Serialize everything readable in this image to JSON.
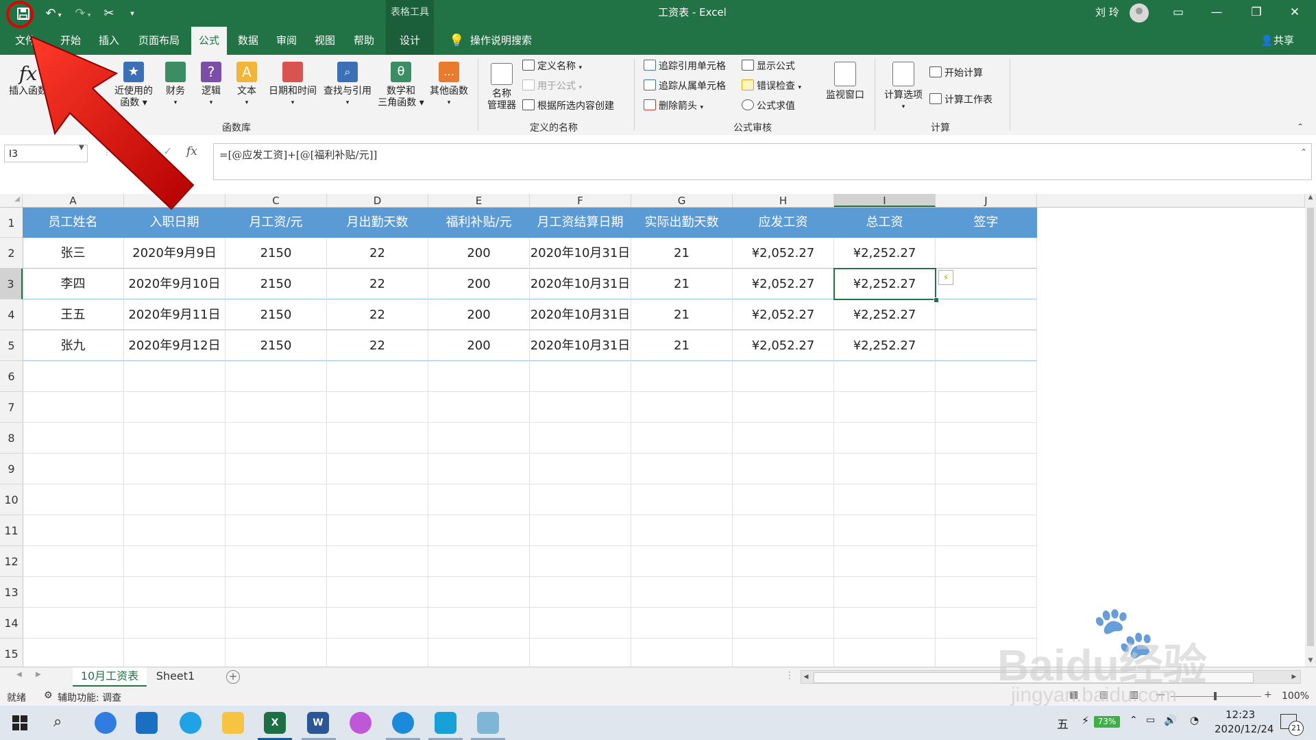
{
  "titlebar": {
    "context_tools": "表格工具",
    "window_title": "工资表 - Excel",
    "user": "刘 玲"
  },
  "tabs": [
    {
      "label": "文件"
    },
    {
      "label": "开始"
    },
    {
      "label": "插入"
    },
    {
      "label": "页面布局"
    },
    {
      "label": "公式"
    },
    {
      "label": "数据"
    },
    {
      "label": "审阅"
    },
    {
      "label": "视图"
    },
    {
      "label": "帮助"
    },
    {
      "label": "设计"
    }
  ],
  "tell_me": "操作说明搜索",
  "share": "共享",
  "ribbon": {
    "function_library": {
      "label": "函数库",
      "insert_function": "插入函数",
      "recent": [
        "近使用的",
        "函数"
      ],
      "financial": "财务",
      "logical": "逻辑",
      "text": "文本",
      "datetime": "日期和时间",
      "lookup": "查找与引用",
      "math": [
        "数学和",
        "三角函数"
      ],
      "more": "其他函数"
    },
    "defined_names": {
      "label": "定义的名称",
      "name_manager": [
        "名称",
        "管理器"
      ],
      "define_name": "定义名称",
      "use_in_formula": "用于公式",
      "create_from_selection": "根据所选内容创建"
    },
    "formula_auditing": {
      "label": "公式审核",
      "trace_precedents": "追踪引用单元格",
      "trace_dependents": "追踪从属单元格",
      "remove_arrows": "删除箭头",
      "show_formulas": "显示公式",
      "error_checking": "错误检查",
      "evaluate_formula": "公式求值",
      "watch_window": "监视窗口"
    },
    "calculation": {
      "label": "计算",
      "calc_options": "计算选项",
      "calc_now": "开始计算",
      "calc_sheet": "计算工作表"
    }
  },
  "formula_bar": {
    "name_box": "I3",
    "formula": "=[@应发工资]+[@[福利补贴/元]]"
  },
  "columns": [
    "A",
    "B",
    "C",
    "D",
    "E",
    "F",
    "G",
    "H",
    "I",
    "J"
  ],
  "rows": [
    "1",
    "2",
    "3",
    "4",
    "5",
    "6",
    "7",
    "8",
    "9",
    "10",
    "11",
    "12",
    "13",
    "14",
    "15"
  ],
  "table": {
    "headers": [
      "员工姓名",
      "入职日期",
      "月工资/元",
      "月出勤天数",
      "福利补贴/元",
      "月工资结算日期",
      "实际出勤天数",
      "应发工资",
      "总工资",
      "签字"
    ],
    "rows": [
      [
        "张三",
        "2020年9月9日",
        "2150",
        "22",
        "200",
        "2020年10月31日",
        "21",
        "¥2,052.27",
        "¥2,252.27",
        ""
      ],
      [
        "李四",
        "2020年9月10日",
        "2150",
        "22",
        "200",
        "2020年10月31日",
        "21",
        "¥2,052.27",
        "¥2,252.27",
        ""
      ],
      [
        "王五",
        "2020年9月11日",
        "2150",
        "22",
        "200",
        "2020年10月31日",
        "21",
        "¥2,052.27",
        "¥2,252.27",
        ""
      ],
      [
        "张九",
        "2020年9月12日",
        "2150",
        "22",
        "200",
        "2020年10月31日",
        "21",
        "¥2,052.27",
        "¥2,252.27",
        ""
      ]
    ]
  },
  "sheets": [
    {
      "label": "10月工资表",
      "active": true
    },
    {
      "label": "Sheet1",
      "active": false
    }
  ],
  "status": {
    "ready": "就绪",
    "accessibility": "辅助功能: 调查",
    "zoom": "100%"
  },
  "taskbar": {
    "ime": "五",
    "battery": "73%",
    "time": "12:23",
    "date": "2020/12/24",
    "notifications": "21"
  },
  "watermark": {
    "logo": "Baidu经验",
    "url": "jingyan.baidu.com"
  },
  "colors": {
    "excel_green": "#217346",
    "table_header": "#5b9bd5",
    "arrow_red": "#e00000"
  }
}
